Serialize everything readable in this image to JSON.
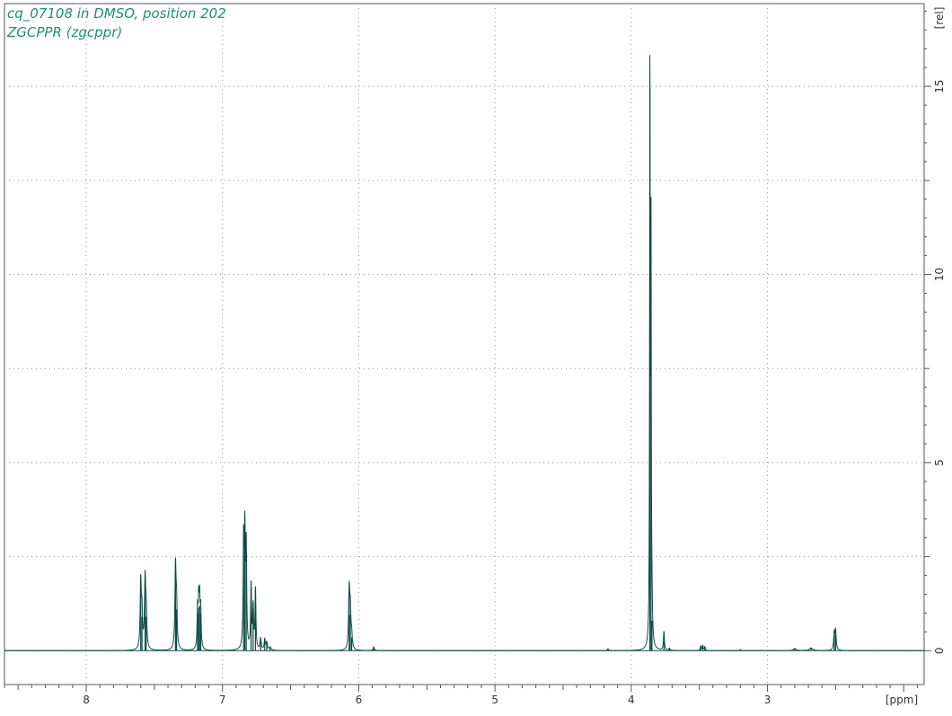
{
  "header": {
    "line1": "cq_07108 in DMSO, position 202",
    "line2": "ZGCPPR (zgcppr)",
    "color": "#1a8f74"
  },
  "chart_data": {
    "type": "line",
    "x_unit_label": "[ppm]",
    "y_unit_label": "[rel]",
    "x_range": [
      8.6,
      1.85
    ],
    "y_range": [
      -0.9,
      17.2
    ],
    "x_ticks": [
      8,
      7,
      6,
      5,
      4,
      3
    ],
    "y_ticks": [
      0,
      5,
      10,
      15
    ],
    "grid": "dotted",
    "line_color": "#0e4a45",
    "label_color": "#2a5a5a",
    "peaks": [
      {
        "x": 7.6,
        "y": 1.75,
        "w": 0.005
      },
      {
        "x": 7.591,
        "y": 0.9,
        "w": 0.005
      },
      {
        "x": 7.568,
        "y": 1.8,
        "w": 0.005
      },
      {
        "x": 7.56,
        "y": 0.9,
        "w": 0.005
      },
      {
        "x": 7.345,
        "y": 2.15,
        "w": 0.005
      },
      {
        "x": 7.337,
        "y": 1.1,
        "w": 0.005
      },
      {
        "x": 7.183,
        "y": 1.0,
        "w": 0.004
      },
      {
        "x": 7.175,
        "y": 1.15,
        "w": 0.004
      },
      {
        "x": 7.168,
        "y": 1.2,
        "w": 0.004
      },
      {
        "x": 7.16,
        "y": 1.0,
        "w": 0.004
      },
      {
        "x": 6.845,
        "y": 2.75,
        "w": 0.004
      },
      {
        "x": 6.836,
        "y": 2.9,
        "w": 0.004
      },
      {
        "x": 6.826,
        "y": 2.6,
        "w": 0.004
      },
      {
        "x": 6.79,
        "y": 1.7,
        "w": 0.004
      },
      {
        "x": 6.775,
        "y": 1.1,
        "w": 0.004
      },
      {
        "x": 6.758,
        "y": 1.6,
        "w": 0.004
      },
      {
        "x": 6.72,
        "y": 0.3,
        "w": 0.005
      },
      {
        "x": 6.69,
        "y": 0.28,
        "w": 0.005
      },
      {
        "x": 6.675,
        "y": 0.2,
        "w": 0.005
      },
      {
        "x": 6.65,
        "y": 0.08,
        "w": 0.008
      },
      {
        "x": 6.07,
        "y": 1.55,
        "w": 0.005
      },
      {
        "x": 6.062,
        "y": 0.95,
        "w": 0.005
      },
      {
        "x": 6.052,
        "y": 0.35,
        "w": 0.005
      },
      {
        "x": 5.89,
        "y": 0.1,
        "w": 0.005
      },
      {
        "x": 4.17,
        "y": 0.05,
        "w": 0.005
      },
      {
        "x": 3.863,
        "y": 14.95,
        "w": 0.0025
      },
      {
        "x": 3.855,
        "y": 10.7,
        "w": 0.0025
      },
      {
        "x": 3.848,
        "y": 0.8,
        "w": 0.004
      },
      {
        "x": 3.76,
        "y": 0.5,
        "w": 0.004
      },
      {
        "x": 3.72,
        "y": 0.06,
        "w": 0.004
      },
      {
        "x": 3.49,
        "y": 0.12,
        "w": 0.004
      },
      {
        "x": 3.475,
        "y": 0.13,
        "w": 0.004
      },
      {
        "x": 3.46,
        "y": 0.1,
        "w": 0.004
      },
      {
        "x": 3.2,
        "y": 0.03,
        "w": 0.005
      },
      {
        "x": 2.8,
        "y": 0.06,
        "w": 0.012
      },
      {
        "x": 2.68,
        "y": 0.07,
        "w": 0.015
      },
      {
        "x": 2.51,
        "y": 0.45,
        "w": 0.005
      },
      {
        "x": 2.5,
        "y": 0.5,
        "w": 0.005
      }
    ]
  }
}
